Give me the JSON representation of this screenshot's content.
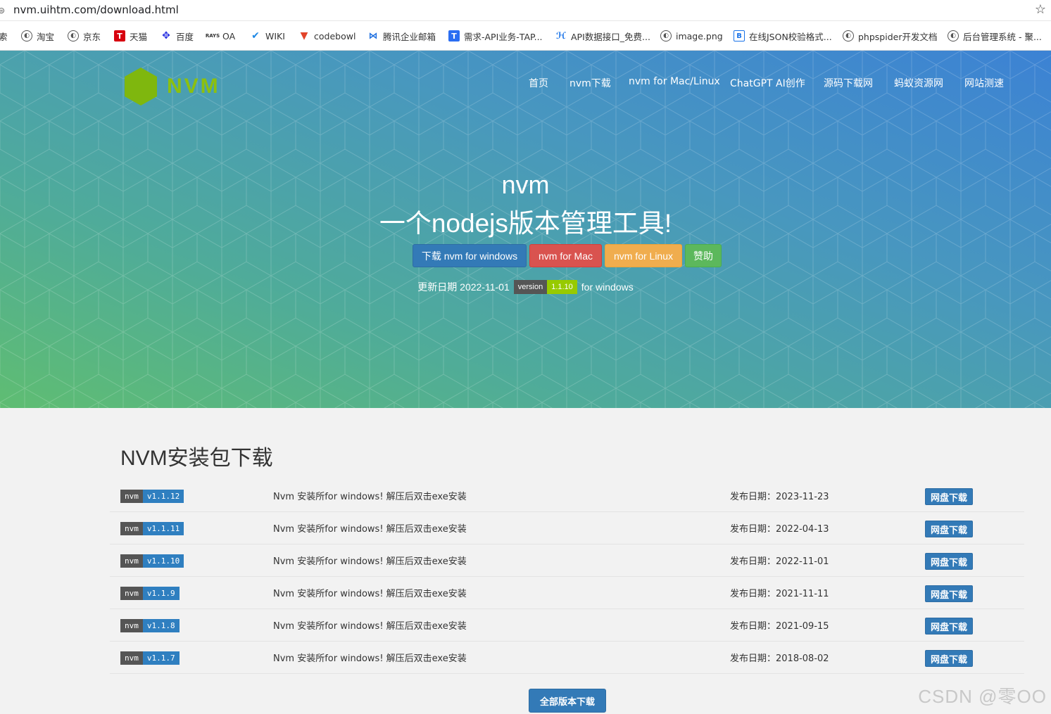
{
  "browser": {
    "url": "nvm.uihtm.com/download.html",
    "bookmarks": [
      {
        "label": "淘宝",
        "icon": "globe-icon"
      },
      {
        "label": "京东",
        "icon": "globe-icon"
      },
      {
        "label": "天猫",
        "icon": "tmall-icon"
      },
      {
        "label": "百度",
        "icon": "baidu-icon"
      },
      {
        "label": "OA",
        "icon": "oa-icon"
      },
      {
        "label": "WIKI",
        "icon": "check-icon"
      },
      {
        "label": "codebowl",
        "icon": "gitlab-icon"
      },
      {
        "label": "腾讯企业邮箱",
        "icon": "mail-icon"
      },
      {
        "label": "需求-API业务-TAP...",
        "icon": "tapd-icon"
      },
      {
        "label": "API数据接口_免费...",
        "icon": "api-icon"
      },
      {
        "label": "image.png",
        "icon": "globe-icon"
      },
      {
        "label": "在线JSON校验格式...",
        "icon": "json-icon"
      },
      {
        "label": "phpspider开发文档",
        "icon": "globe-icon"
      },
      {
        "label": "后台管理系统 - 聚...",
        "icon": "globe-icon"
      }
    ]
  },
  "site": {
    "logo_text": "NVM",
    "nav": [
      "首页",
      "nvm下载",
      "nvm for Mac/Linux",
      "ChatGPT AI创作",
      "源码下载网",
      "蚂蚁资源网",
      "网站测速"
    ],
    "hero_title": "nvm",
    "hero_subtitle": "一个nodejs版本管理工具!",
    "buttons": {
      "windows": "下载 nvm for windows",
      "mac": "nvm for Mac",
      "linux": "nvm for Linux",
      "donate": "赞助"
    },
    "update_prefix": "更新日期 2022-11-01",
    "version_label": "version",
    "version_value": "1.1.10",
    "update_suffix": "for windows"
  },
  "downloads": {
    "title": "NVM安装包下载",
    "rows": [
      {
        "badge_label": "nvm",
        "version": "v1.1.12",
        "desc": "Nvm 安装所for windows! 解压后双击exe安装",
        "date": "发布日期：2023-11-23",
        "button": "网盘下载"
      },
      {
        "badge_label": "nvm",
        "version": "v1.1.11",
        "desc": "Nvm 安装所for windows! 解压后双击exe安装",
        "date": "发布日期：2022-04-13",
        "button": "网盘下载"
      },
      {
        "badge_label": "nvm",
        "version": "v1.1.10",
        "desc": "Nvm 安装所for windows! 解压后双击exe安装",
        "date": "发布日期：2022-11-01",
        "button": "网盘下载"
      },
      {
        "badge_label": "nvm",
        "version": "v1.1.9",
        "desc": "Nvm 安装所for windows! 解压后双击exe安装",
        "date": "发布日期：2021-11-11",
        "button": "网盘下载"
      },
      {
        "badge_label": "nvm",
        "version": "v1.1.8",
        "desc": "Nvm 安装所for windows! 解压后双击exe安装",
        "date": "发布日期：2021-09-15",
        "button": "网盘下载"
      },
      {
        "badge_label": "nvm",
        "version": "v1.1.7",
        "desc": "Nvm 安装所for windows! 解压后双击exe安装",
        "date": "发布日期：2018-08-02",
        "button": "网盘下载"
      }
    ],
    "all_versions_button": "全部版本下载"
  },
  "watermark": "CSDN @零OO",
  "colors": {
    "primary": "#337ab7",
    "danger": "#d9534f",
    "warning": "#f0ad4e",
    "success": "#5cb85c",
    "logo_green": "#8cc00f",
    "badge_dark": "#555555",
    "badge_version": "#97ca00"
  }
}
